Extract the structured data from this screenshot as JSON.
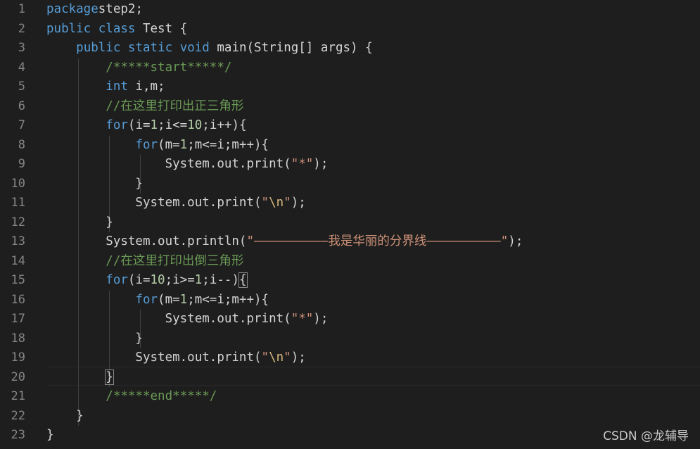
{
  "editor": {
    "lines": [
      {
        "n": "1",
        "code": [
          [
            "kw",
            "package"
          ],
          [
            "",
            "step2;"
          ]
        ]
      },
      {
        "n": "2",
        "code": [
          [
            "kw",
            "public"
          ],
          [
            "",
            " "
          ],
          [
            "kw",
            "class"
          ],
          [
            "",
            " Test {"
          ]
        ]
      },
      {
        "n": "3",
        "code": [
          [
            "",
            "    "
          ],
          [
            "kw",
            "public"
          ],
          [
            "",
            " "
          ],
          [
            "kw",
            "static"
          ],
          [
            "",
            " "
          ],
          [
            "kw",
            "void"
          ],
          [
            "",
            " main(String[] args) {"
          ]
        ]
      },
      {
        "n": "4",
        "code": [
          [
            "",
            "        "
          ],
          [
            "com",
            "/*****start*****/"
          ]
        ]
      },
      {
        "n": "5",
        "code": [
          [
            "",
            "        "
          ],
          [
            "kw",
            "int"
          ],
          [
            "",
            " i,m;"
          ]
        ]
      },
      {
        "n": "6",
        "code": [
          [
            "",
            "        "
          ],
          [
            "com",
            "//在这里打印出正三角形"
          ]
        ]
      },
      {
        "n": "7",
        "code": [
          [
            "",
            "        "
          ],
          [
            "ctrl",
            "for"
          ],
          [
            "",
            "(i="
          ],
          [
            "num",
            "1"
          ],
          [
            "",
            ";i<="
          ],
          [
            "num",
            "10"
          ],
          [
            "",
            ";i++){"
          ]
        ]
      },
      {
        "n": "8",
        "code": [
          [
            "",
            "            "
          ],
          [
            "ctrl",
            "for"
          ],
          [
            "",
            "(m="
          ],
          [
            "num",
            "1"
          ],
          [
            "",
            ";m<=i;m++){"
          ]
        ]
      },
      {
        "n": "9",
        "code": [
          [
            "",
            "                System.out.print("
          ],
          [
            "str",
            "\"*\""
          ],
          [
            "",
            ");"
          ]
        ]
      },
      {
        "n": "10",
        "code": [
          [
            "",
            "            }"
          ]
        ]
      },
      {
        "n": "11",
        "code": [
          [
            "",
            "            System.out.print("
          ],
          [
            "str",
            "\""
          ],
          [
            "esc",
            "\\n"
          ],
          [
            "str",
            "\""
          ],
          [
            "",
            ");"
          ]
        ]
      },
      {
        "n": "12",
        "code": [
          [
            "",
            "        }"
          ]
        ]
      },
      {
        "n": "13",
        "code": [
          [
            "",
            "        System.out.println("
          ],
          [
            "str",
            "\"——————————我是华丽的分界线——————————\""
          ],
          [
            "",
            ");"
          ]
        ]
      },
      {
        "n": "14",
        "code": [
          [
            "",
            "        "
          ],
          [
            "com",
            "//在这里打印出倒三角形"
          ]
        ]
      },
      {
        "n": "15",
        "code": [
          [
            "",
            "        "
          ],
          [
            "ctrl",
            "for"
          ],
          [
            "",
            "(i="
          ],
          [
            "num",
            "10"
          ],
          [
            "",
            ";i>="
          ],
          [
            "num",
            "1"
          ],
          [
            "",
            ";i--)"
          ],
          [
            "brace",
            "{"
          ]
        ]
      },
      {
        "n": "16",
        "code": [
          [
            "",
            "            "
          ],
          [
            "ctrl",
            "for"
          ],
          [
            "",
            "(m="
          ],
          [
            "num",
            "1"
          ],
          [
            "",
            ";m<=i;m++){"
          ]
        ]
      },
      {
        "n": "17",
        "code": [
          [
            "",
            "                System.out.print("
          ],
          [
            "str",
            "\"*\""
          ],
          [
            "",
            ");"
          ]
        ]
      },
      {
        "n": "18",
        "code": [
          [
            "",
            "            }"
          ]
        ]
      },
      {
        "n": "19",
        "code": [
          [
            "",
            "            System.out.print("
          ],
          [
            "str",
            "\""
          ],
          [
            "esc",
            "\\n"
          ],
          [
            "str",
            "\""
          ],
          [
            "",
            ");"
          ]
        ]
      },
      {
        "n": "20",
        "code": [
          [
            "",
            "        "
          ],
          [
            "brace",
            "}"
          ]
        ]
      },
      {
        "n": "21",
        "code": [
          [
            "",
            "        "
          ],
          [
            "com",
            "/*****end*****/"
          ]
        ]
      },
      {
        "n": "22",
        "code": [
          [
            "",
            "    }"
          ]
        ]
      },
      {
        "n": "23",
        "code": [
          [
            "",
            "}"
          ]
        ]
      }
    ]
  },
  "watermark": "CSDN @龙辅导",
  "colors": {
    "background": "#1e1e1e",
    "keyword": "#569cd6",
    "string": "#ce9178",
    "comment": "#6a9955",
    "number": "#b5cea8",
    "line_number": "#858585",
    "text": "#d4d4d4"
  }
}
